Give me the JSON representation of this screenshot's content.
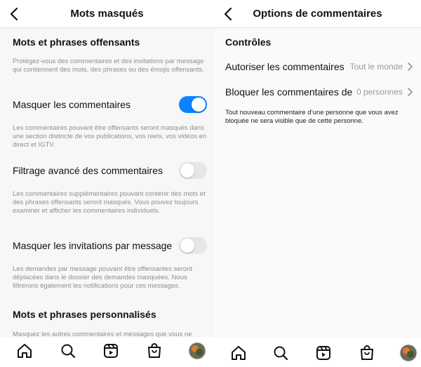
{
  "left": {
    "header_title": "Mots masqués",
    "section1_title": "Mots et phrases offensants",
    "section1_desc": "Protégez-vous des commentaires et des invitations par message qui contiennent des mots, des phrases ou des émojis offensants.",
    "toggles": [
      {
        "label": "Masquer les commentaires",
        "state": true,
        "desc": "Les commentaires pouvant être offensants seront masqués dans une section distincte de vos publications, vos reels, vos vidéos en direct et IGTV."
      },
      {
        "label": "Filtrage avancé des commentaires",
        "state": false,
        "desc": "Les commentaires supplémentaires pouvant contenir des mots et des phrases offensants seront masqués. Vous pouvez toujours examiner et afficher les commentaires individuels."
      },
      {
        "label": "Masquer les invitations par message",
        "state": false,
        "desc": "Les demandes par message pouvant être offensantes seront déplacées dans le dossier des demandes masquées. Nous filtrerons également les notifications pour ces messages."
      }
    ],
    "section2_title": "Mots et phrases personnalisés",
    "section2_desc": "Masquez les autres commentaires et messages que vous ne souhaitez pas voir en créant une liste personnalisée de"
  },
  "right": {
    "header_title": "Options de commentaires",
    "section_title": "Contrôles",
    "rows": [
      {
        "label": "Autoriser les commentaires",
        "value": "Tout le monde"
      },
      {
        "label": "Bloquer les commentaires de",
        "value": "0 personnes"
      }
    ],
    "note": "Tout nouveau commentaire d’une personne que vous avez bloquée ne sera visible que de cette personne."
  },
  "navbar_icons": [
    "home-icon",
    "search-icon",
    "reels-icon",
    "shop-icon",
    "profile-avatar"
  ],
  "colors": {
    "toggle_on": "#0a84ff",
    "toggle_off": "#e6e6e6",
    "muted_text": "#8e8e8e"
  }
}
